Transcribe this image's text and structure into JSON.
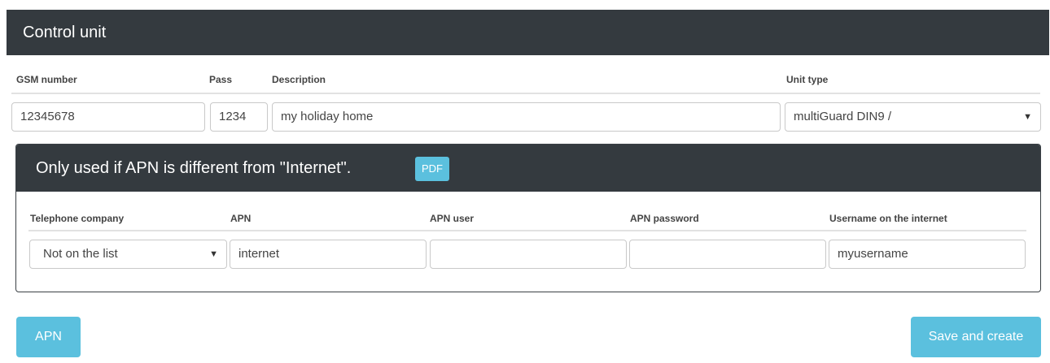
{
  "header": {
    "title": "Control unit"
  },
  "unit_form": {
    "labels": {
      "gsm": "GSM number",
      "pass": "Pass",
      "description": "Description",
      "unit_type": "Unit type"
    },
    "values": {
      "gsm": "12345678",
      "pass": "1234",
      "description": "my holiday home",
      "unit_type": "multiGuard DIN9 /"
    }
  },
  "apn_panel": {
    "title": "Only used if APN is different from \"Internet\".",
    "pdf_label": "PDF",
    "labels": {
      "company": "Telephone company",
      "apn": "APN",
      "apn_user": "APN user",
      "apn_password": "APN password",
      "username": "Username on the internet"
    },
    "values": {
      "company": "Not on the list",
      "apn": "internet",
      "apn_user": "",
      "apn_password": "",
      "username": "myusername"
    }
  },
  "buttons": {
    "apn": "APN",
    "save": "Save and create"
  },
  "icons": {
    "select_arrow": "▼"
  },
  "colors": {
    "header_bg": "#343a3f",
    "accent": "#5bc0de"
  }
}
